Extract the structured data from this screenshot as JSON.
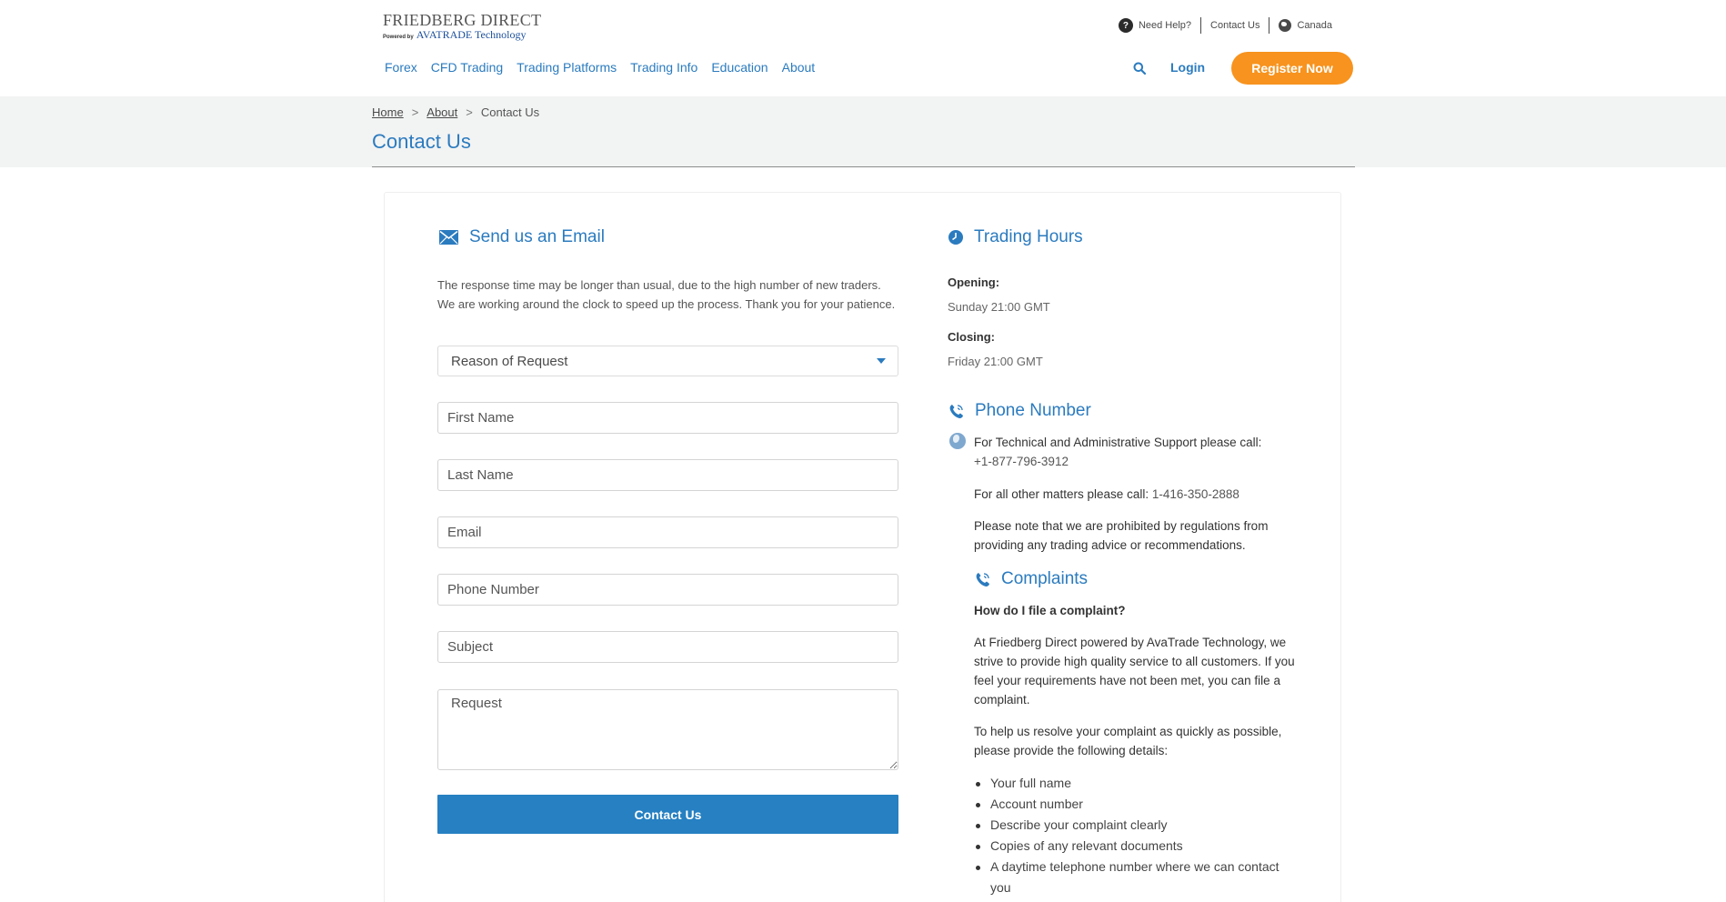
{
  "header": {
    "logo_main": "FRIEDBERG DIRECT",
    "logo_powered": "Powered by",
    "logo_ava": "AVATRADE Technology",
    "need_help": "Need Help?",
    "contact_us": "Contact Us",
    "country": "Canada",
    "nav": [
      "Forex",
      "CFD Trading",
      "Trading Platforms",
      "Trading Info",
      "Education",
      "About"
    ],
    "login": "Login",
    "register": "Register Now"
  },
  "breadcrumb": {
    "home": "Home",
    "about": "About",
    "current": "Contact Us",
    "separator": ">"
  },
  "page_title": "Contact Us",
  "email_section": {
    "title": "Send us an Email",
    "note": "The response time may be longer than usual, due to the high number of new traders. We are working around the clock to speed up the process. Thank you for your patience.",
    "select_label": "Reason of Request",
    "fields": {
      "first_name": "First Name",
      "last_name": "Last Name",
      "email": "Email",
      "phone": "Phone Number",
      "subject": "Subject",
      "request": "Request"
    },
    "submit": "Contact Us"
  },
  "trading_hours": {
    "title": "Trading Hours",
    "opening_label": "Opening:",
    "opening_value": "Sunday 21:00 GMT",
    "closing_label": "Closing:",
    "closing_value": "Friday 21:00 GMT"
  },
  "phone_section": {
    "title": "Phone Number",
    "tech_text": "For Technical and Administrative Support please call:",
    "tech_number": "+1-877-796-3912",
    "other_text": "For all other matters please call:",
    "other_number": "1-416-350-2888",
    "disclaimer": "Please note that we are prohibited by regulations from providing any trading advice or recommendations."
  },
  "complaints": {
    "title": "Complaints",
    "question": "How do I file a complaint?",
    "para1": "At Friedberg Direct powered by AvaTrade Technology, we strive to provide high quality service to all customers. If you feel your requirements have not been met, you can file a complaint.",
    "para2": "To help us resolve your complaint as quickly as possible, please provide the following details:",
    "items": [
      "Your full name",
      "Account number",
      "Describe your complaint clearly",
      "Copies of any relevant documents",
      "A daytime telephone number where we can contact you"
    ]
  },
  "colors": {
    "accent": "#2b7bbf",
    "button": "#2680c2",
    "register": "#f7931e",
    "band": "#f2f3f3"
  }
}
